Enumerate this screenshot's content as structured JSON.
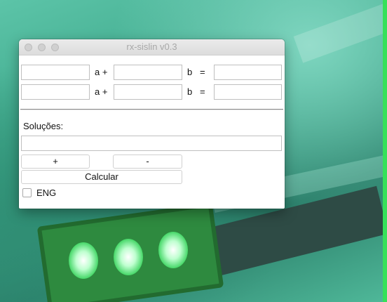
{
  "window": {
    "title": "rx-sislin v0.3"
  },
  "equations": [
    {
      "a_label": "a +",
      "b_label": "b",
      "eq_label": "=",
      "a_value": "",
      "b_value": "",
      "result_value": ""
    },
    {
      "a_label": "a +",
      "b_label": "b",
      "eq_label": "=",
      "a_value": "",
      "b_value": "",
      "result_value": ""
    }
  ],
  "solutions": {
    "label": "Soluções:",
    "value": ""
  },
  "buttons": {
    "add": "+",
    "remove": "-",
    "calculate": "Calcular"
  },
  "language": {
    "label": "ENG",
    "checked": false
  }
}
